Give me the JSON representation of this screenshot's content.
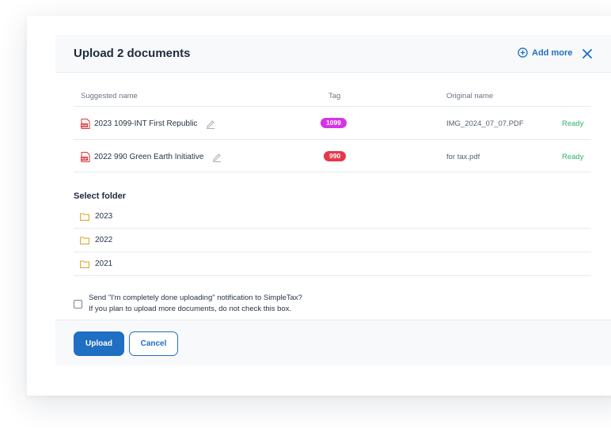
{
  "modal": {
    "title": "Upload 2 documents",
    "add_more_label": "Add more"
  },
  "table": {
    "headers": {
      "name": "Suggested name",
      "tag": "Tag",
      "original": "Original name"
    },
    "rows": [
      {
        "name": "2023 1099-INT First Republic",
        "tag": "1099",
        "tag_color": "#d633e6",
        "original": "IMG_2024_07_07.PDF",
        "status": "Ready"
      },
      {
        "name": "2022 990 Green Earth Initiative",
        "tag": "990",
        "tag_color": "#e5384a",
        "original": "for tax.pdf",
        "status": "Ready"
      }
    ]
  },
  "folders": {
    "title": "Select folder",
    "items": [
      "2023",
      "2022",
      "2021"
    ]
  },
  "notify": {
    "line1": "Send \"I'm completely done uploading\" notification to SimpleTax?",
    "line2": "If you plan to upload more documents, do not check this box.",
    "checked": false
  },
  "footer": {
    "upload_label": "Upload",
    "cancel_label": "Cancel"
  },
  "colors": {
    "accent": "#1f6fc2",
    "ready": "#2fb36b",
    "folder": "#e0a82e",
    "pdf": "#d9363e"
  },
  "icons": {
    "add": "plus-circle-icon",
    "close": "close-icon",
    "file": "pdf-icon",
    "edit": "pencil-icon",
    "folder": "folder-icon"
  }
}
